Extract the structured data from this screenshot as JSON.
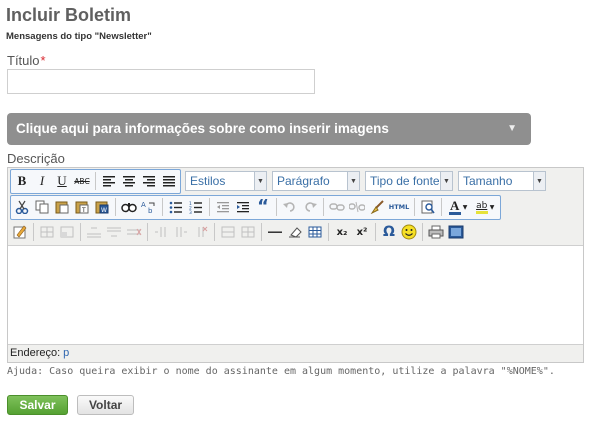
{
  "page": {
    "title": "Incluir Boletim",
    "subtitle": "Mensagens do tipo \"Newsletter\""
  },
  "form": {
    "titulo_label": "Título",
    "titulo_required_mark": "*",
    "titulo_value": "",
    "info_bar_text": "Clique aqui para informações sobre como inserir imagens",
    "descricao_label": "Descrição"
  },
  "editor": {
    "toolbar_row1": {
      "bold": "B",
      "italic": "I",
      "underline": "U",
      "strike": "ABC",
      "align_icons": [
        "align-left-icon",
        "align-center-icon",
        "align-right-icon",
        "align-justify-icon"
      ],
      "selects": [
        {
          "name": "styles",
          "value": "Estilos"
        },
        {
          "name": "paragraph",
          "value": "Parágrafo"
        },
        {
          "name": "font",
          "value": "Tipo de fonte"
        },
        {
          "name": "size",
          "value": "Tamanho"
        }
      ]
    },
    "toolbar_row2": {
      "icons": [
        "cut-icon",
        "copy-icon",
        "paste-icon",
        "paste-text-icon",
        "paste-word-icon",
        "find-icon",
        "replace-icon",
        "bullet-list-icon",
        "numbered-list-icon",
        "outdent-icon",
        "indent-icon",
        "blockquote-icon",
        "undo-icon",
        "redo-icon",
        "link-icon",
        "unlink-icon",
        "cleanup-icon",
        "html-icon",
        "preview-icon",
        "text-color-icon",
        "highlight-color-icon"
      ],
      "html_label": "HTML",
      "quote_glyph": "“",
      "text_color_label": "A",
      "highlight_label": "ab"
    },
    "toolbar_row3": {
      "icons": [
        "visual-aid-icon",
        "table-props-icon",
        "cell-props-icon",
        "row-before-icon",
        "row-after-icon",
        "delete-row-icon",
        "col-before-icon",
        "col-after-icon",
        "delete-col-icon",
        "merge-cells-icon",
        "split-cells-icon",
        "hr-icon",
        "eraser-icon",
        "table-icon",
        "subscript-icon",
        "superscript-icon",
        "omega-icon",
        "smiley-icon",
        "print-icon",
        "fullscreen-icon"
      ],
      "subscript_label": "x₂",
      "superscript_label": "x²",
      "omega_label": "Ω"
    },
    "status": {
      "label": "Endereço:",
      "path": "p"
    },
    "colors": {
      "accent_blue": "#2f66b0",
      "toolbar_bg": "#f0f0ee",
      "group_border": "#7ca7d8"
    }
  },
  "help": "Ajuda: Caso queira exibir o nome do assinante em algum momento, utilize a palavra \"%NOME%\".",
  "buttons": {
    "save": "Salvar",
    "back": "Voltar",
    "save_color": "#5aa536"
  }
}
